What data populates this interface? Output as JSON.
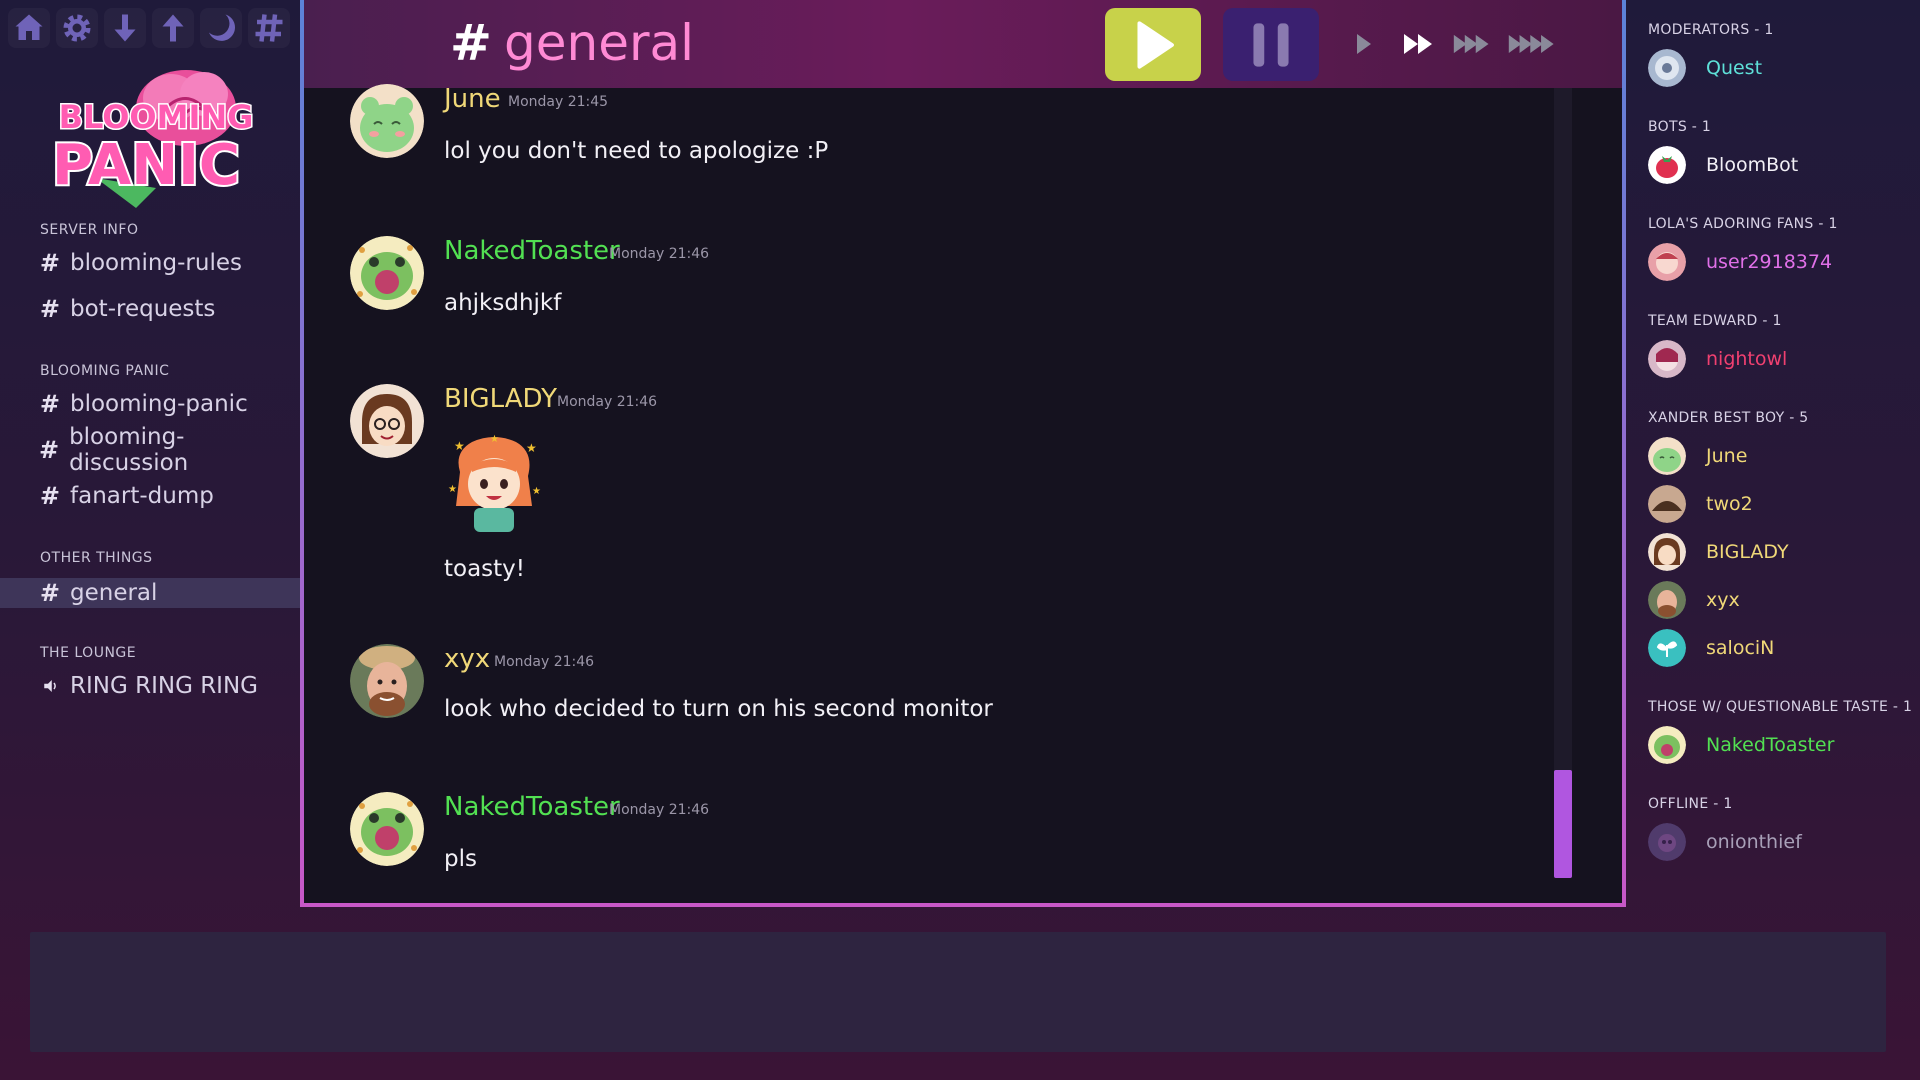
{
  "app": {
    "name": "Blooming Panic"
  },
  "toolbar": {
    "icons": [
      "home-icon",
      "gear-icon",
      "arrow-down-icon",
      "arrow-up-icon",
      "moon-icon",
      "hash-icon"
    ]
  },
  "logo": {
    "line1": "BLOOMING",
    "line2": "PANIC"
  },
  "sidebar": {
    "categories": [
      {
        "label": "SERVER INFO",
        "channels": [
          {
            "name": "blooming-rules"
          },
          {
            "name": "bot-requests"
          }
        ]
      },
      {
        "label": "BLOOMING PANIC",
        "channels": [
          {
            "name": "blooming-panic"
          },
          {
            "name": "blooming-discussion"
          },
          {
            "name": "fanart-dump"
          }
        ]
      },
      {
        "label": "OTHER THINGS",
        "channels": [
          {
            "name": "general"
          }
        ]
      },
      {
        "label": "THE LOUNGE",
        "channels": [
          {
            "name": "RING RING RING"
          }
        ]
      }
    ]
  },
  "header": {
    "hash": "#",
    "channel": "general"
  },
  "messages": [
    {
      "author": "June",
      "color": "#f0d878",
      "time": "Monday 21:45",
      "text": "lol you don't need to apologize :P"
    },
    {
      "author": "NakedToaster",
      "color": "#52e052",
      "time": "Monday 21:46",
      "text": "ahjksdhjkf"
    },
    {
      "author": "BIGLADY",
      "color": "#f0d878",
      "time": "Monday 21:46",
      "text": "toasty!",
      "has_sticker": true
    },
    {
      "author": "xyx",
      "color": "#f0d878",
      "time": "Monday 21:46",
      "text": "look who decided to turn on his second monitor"
    },
    {
      "author": "NakedToaster",
      "color": "#52e052",
      "time": "Monday 21:46",
      "text": "pls"
    }
  ],
  "members": {
    "groups": [
      {
        "label": "MODERATORS - 1",
        "users": [
          {
            "name": "Quest",
            "color": "#5ee0d8"
          }
        ]
      },
      {
        "label": "BOTS - 1",
        "users": [
          {
            "name": "BloomBot",
            "color": "#f2f0f6"
          }
        ]
      },
      {
        "label": "LOLA'S ADORING FANS - 1",
        "users": [
          {
            "name": "user2918374",
            "color": "#e070e8"
          }
        ]
      },
      {
        "label": "TEAM EDWARD - 1",
        "users": [
          {
            "name": "nightowl",
            "color": "#f04070"
          }
        ]
      },
      {
        "label": "XANDER BEST BOY - 5",
        "users": [
          {
            "name": "June",
            "color": "#f0d878"
          },
          {
            "name": "two2",
            "color": "#f0d878"
          },
          {
            "name": "BIGLADY",
            "color": "#f0d878"
          },
          {
            "name": "xyx",
            "color": "#f0d878"
          },
          {
            "name": "salociN",
            "color": "#f0d878"
          }
        ]
      },
      {
        "label": "THOSE W/ QUESTIONABLE TASTE - 1",
        "users": [
          {
            "name": "NakedToaster",
            "color": "#52e052"
          }
        ]
      },
      {
        "label": "OFFLINE - 1",
        "users": [
          {
            "name": "onionthief",
            "color": "#a8a0b8"
          }
        ]
      }
    ]
  },
  "controls": {
    "play": "play-button",
    "pause": "pause-button",
    "speeds": [
      "1x",
      "2x",
      "3x",
      "4x"
    ]
  },
  "colors": {
    "accent_pink": "#ff8ad4",
    "play_bg": "#c8d24a",
    "pause_bg": "#3a2070",
    "scroll": "#b056e0"
  }
}
